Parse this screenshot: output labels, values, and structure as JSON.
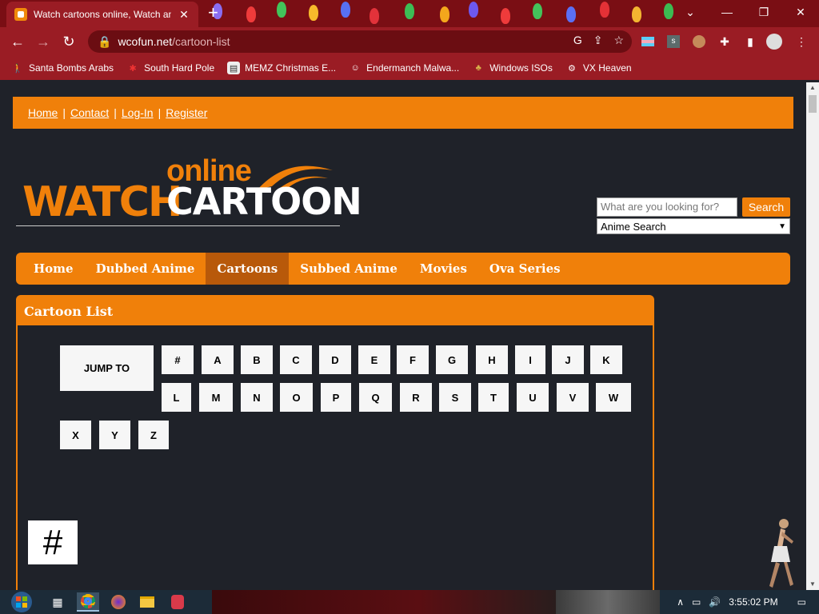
{
  "browser": {
    "tab_title": "Watch cartoons online, Watch an",
    "url_host": "wcofun.net",
    "url_path": "/cartoon-list",
    "bookmarks": [
      {
        "label": "Santa Bombs Arabs",
        "icon": "person-icon"
      },
      {
        "label": "South Hard Pole",
        "icon": "snowflake-icon"
      },
      {
        "label": "MEMZ Christmas E...",
        "icon": "page-icon"
      },
      {
        "label": "Endermanch Malwa...",
        "icon": "raccoon-icon"
      },
      {
        "label": "Windows ISOs",
        "icon": "figure-icon"
      },
      {
        "label": "VX Heaven",
        "icon": "gear-skull-icon"
      }
    ]
  },
  "site": {
    "topbar": {
      "home": "Home",
      "contact": "Contact",
      "login": "Log-In",
      "register": "Register",
      "sep": "|"
    },
    "logo": {
      "online": "online",
      "watch": "WATCH",
      "cartoon": "CARTOON"
    },
    "search": {
      "placeholder": "What are you looking for?",
      "button": "Search",
      "select_value": "Anime Search"
    },
    "nav": [
      "Home",
      "Dubbed Anime",
      "Cartoons",
      "Subbed Anime",
      "Movies",
      "Ova Series"
    ],
    "nav_active": "Cartoons",
    "list_title": "Cartoon List",
    "jump_to": "JUMP TO",
    "letters": [
      "#",
      "A",
      "B",
      "C",
      "D",
      "E",
      "F",
      "G",
      "H",
      "I",
      "J",
      "K",
      "L",
      "M",
      "N",
      "O",
      "P",
      "Q",
      "R",
      "S",
      "T",
      "U",
      "V",
      "W",
      "X",
      "Y",
      "Z"
    ],
    "section_heading": "#"
  },
  "taskbar": {
    "clock": "3:55:02 PM"
  },
  "colors": {
    "accent": "#f0800a",
    "page_bg": "#1f2229",
    "chrome": "#9a1c24"
  }
}
